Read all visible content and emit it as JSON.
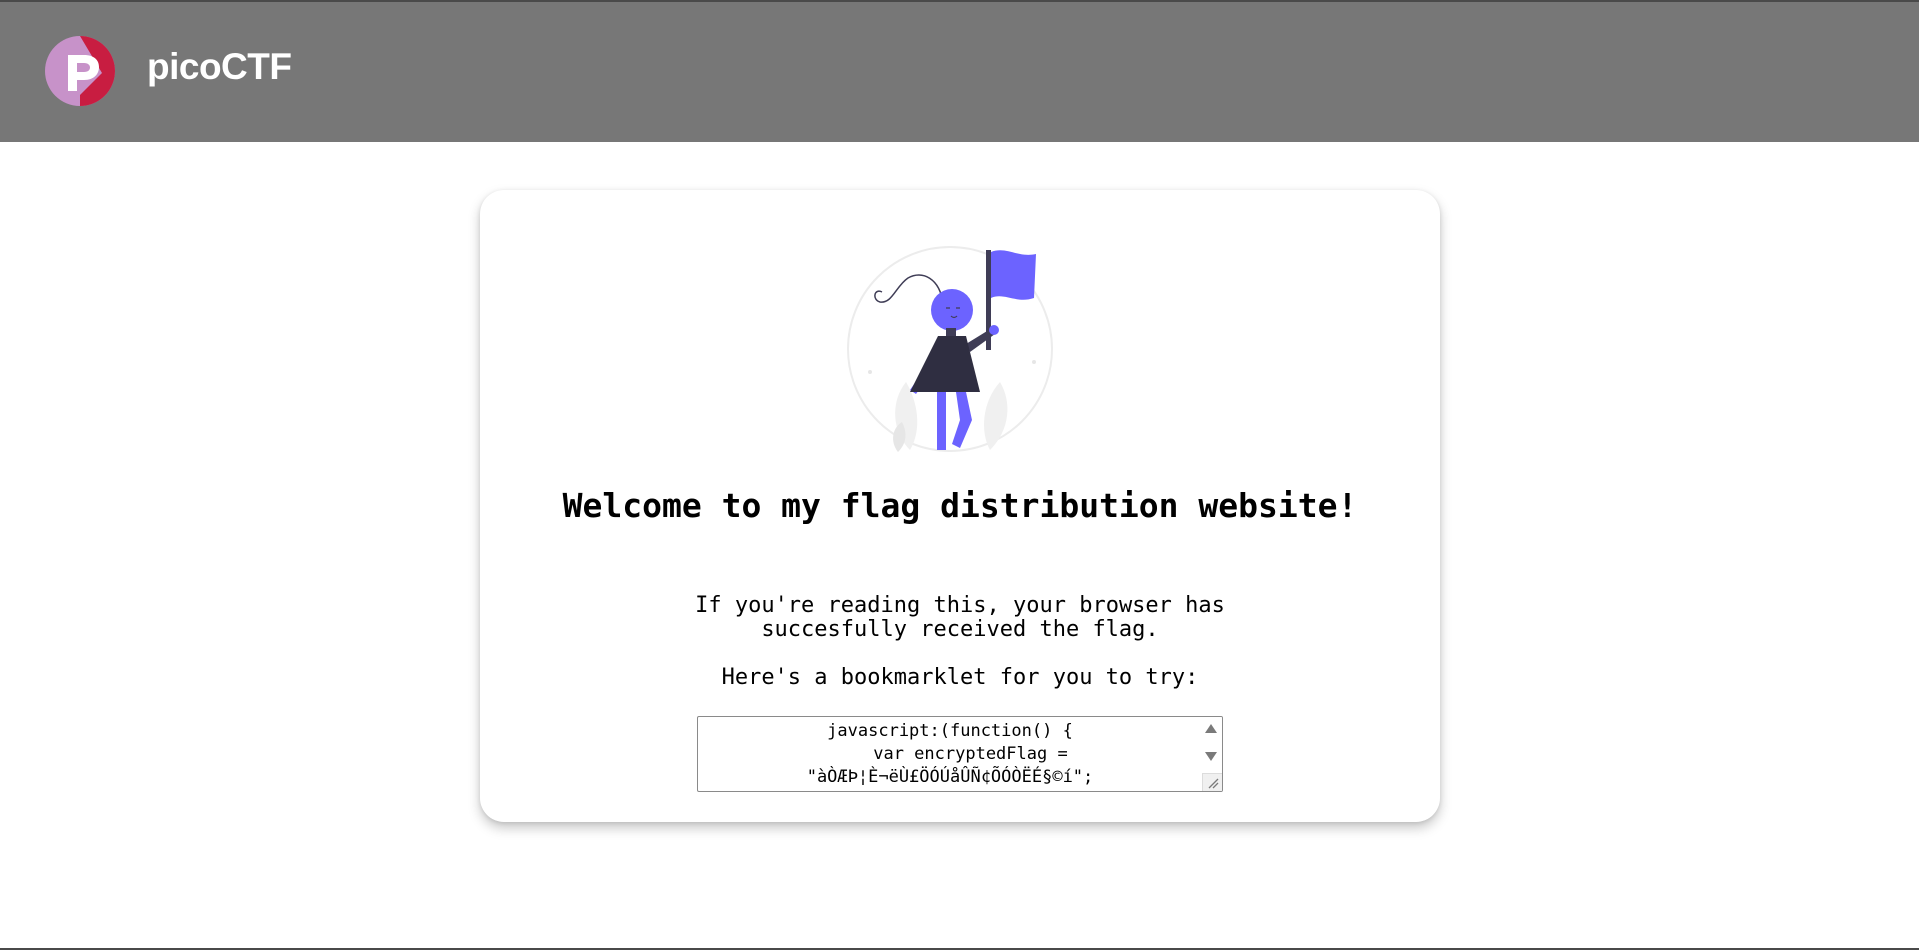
{
  "header": {
    "brand": "picoCTF",
    "background": "#777777"
  },
  "logo": {
    "icon": "picoctf-logo-icon",
    "colors": {
      "circle": "#c792c9",
      "accent": "#c8173a",
      "letter": "#ffffff"
    }
  },
  "card": {
    "illustration_icon": "woman-with-flag-illustration",
    "accent_color": "#6c63ff",
    "title": "Welcome to my flag distribution website!",
    "paragraph_1": "If you're reading this, your browser has succesfully received the flag.",
    "paragraph_2": "Here's a bookmarklet for you to try:",
    "bookmarklet_lines": [
      "javascript:(function() {",
      "    var encryptedFlag =",
      "\"àÒÆÞ¦È¬ëÙ£ÖÓÚåÛÑ¢ÕÓÒËÉ§©í\";"
    ]
  }
}
